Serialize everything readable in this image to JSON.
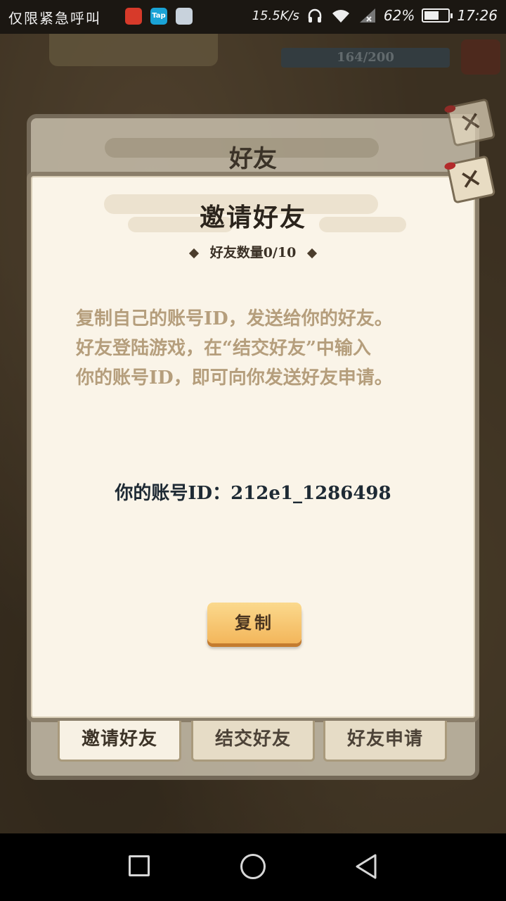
{
  "status_bar": {
    "carrier_text": "仅限紧急呼叫",
    "app_icons": [
      "huawei-app-icon",
      "taptap-app-icon",
      "game-app-icon"
    ],
    "taptap_label": "Tap",
    "net_speed": "15.5K/s",
    "battery_percent": "62%",
    "battery_level": 0.62,
    "time": "17:26"
  },
  "background": {
    "counter": "164/200"
  },
  "back_panel": {
    "title": "好友"
  },
  "dialog": {
    "title": "邀请好友",
    "friend_count": "好友数量0/10",
    "description": [
      "复制自己的账号ID，发送给你的好友。",
      "好友登陆游戏，在“结交好友”中输入",
      "你的账号ID，即可向你发送好友申请。"
    ],
    "account_id": "你的账号ID：212e1_1286498",
    "copy_label": "复制"
  },
  "tabs": [
    {
      "label": "邀请好友",
      "active": true
    },
    {
      "label": "结交好友",
      "active": false
    },
    {
      "label": "好友申请",
      "active": false
    }
  ],
  "colors": {
    "dialog_bg": "#faf4e8",
    "copy_button": "#f3b65b",
    "desc_text": "#b59e7c"
  }
}
